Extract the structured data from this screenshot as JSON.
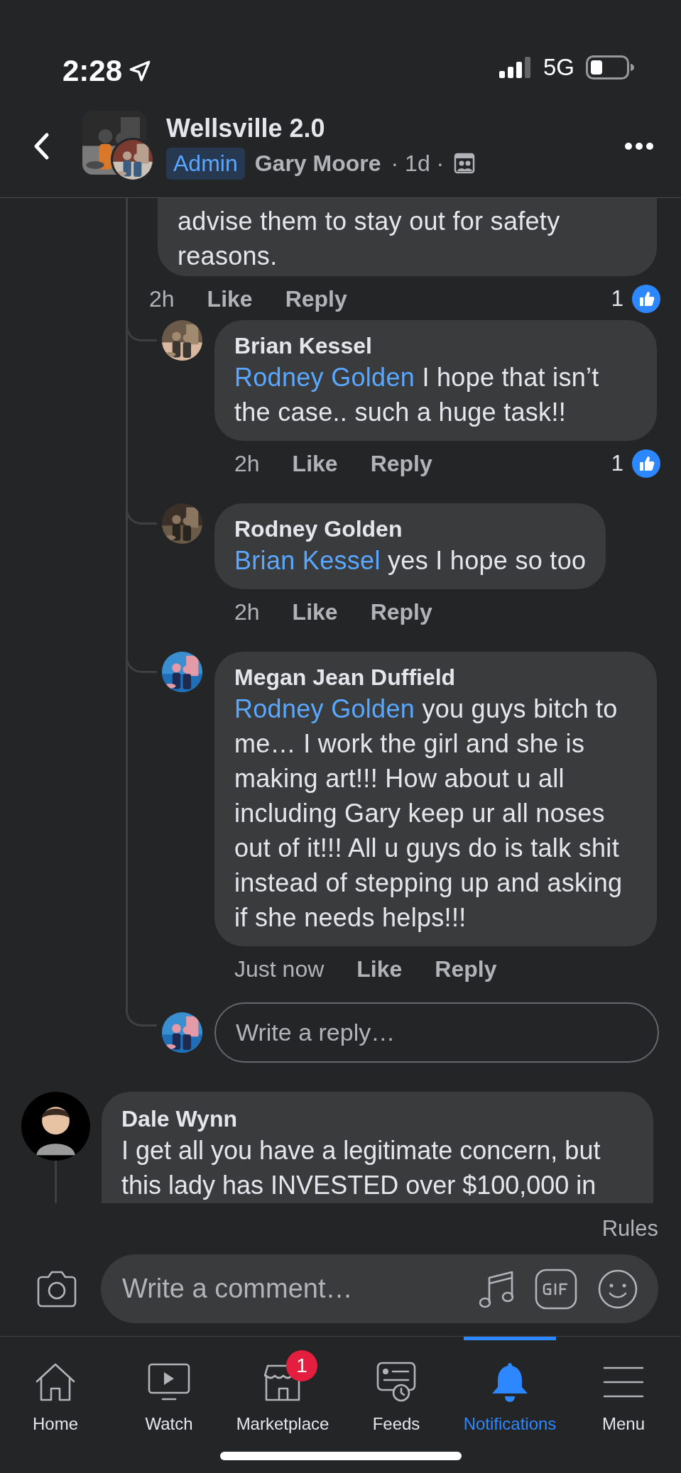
{
  "status_bar": {
    "time": "2:28",
    "network": "5G"
  },
  "header": {
    "title": "Wellsville 2.0",
    "badge": "Admin",
    "author": "Gary Moore",
    "meta": "· 1d ·"
  },
  "partial_comment": {
    "lines": [
      "advise them to stay out for safety",
      "reasons."
    ],
    "time": "2h",
    "like": "Like",
    "reply": "Reply",
    "reactions": "1"
  },
  "replies": [
    {
      "name": "Brian Kessel",
      "mention": "Rodney Golden",
      "text": "I hope that isn’t the case.. such a huge task!!",
      "time": "2h",
      "like": "Like",
      "reply": "Reply",
      "reactions": "1"
    },
    {
      "name": "Rodney Golden",
      "mention": "Brian Kessel",
      "text": "yes I hope so too",
      "time": "2h",
      "like": "Like",
      "reply": "Reply"
    },
    {
      "name": "Megan Jean Duffield",
      "mention": "Rodney Golden",
      "text": "you guys bitch to me… I work the girl and she is making art!!! How about u all including Gary keep ur all noses out of it!!! All u guys do is talk shit instead of stepping up and asking if she needs helps!!!",
      "time": "Just now",
      "like": "Like",
      "reply": "Reply"
    }
  ],
  "reply_field": {
    "placeholder": "Write a reply…"
  },
  "next_comment": {
    "name": "Dale Wynn",
    "lines": [
      "I get all you have a legitimate concern, but",
      "this lady has INVESTED over $100,000 in"
    ]
  },
  "composer": {
    "rules": "Rules",
    "placeholder": "Write a comment…"
  },
  "tabs": [
    {
      "label": "Home",
      "kind": "home",
      "selected": false
    },
    {
      "label": "Watch",
      "kind": "watch",
      "selected": false
    },
    {
      "label": "Marketplace",
      "kind": "shop",
      "badge": "1",
      "selected": false
    },
    {
      "label": "Feeds",
      "kind": "feeds",
      "selected": false
    },
    {
      "label": "Notifications",
      "kind": "bell",
      "selected": true
    },
    {
      "label": "Menu",
      "kind": "menu",
      "selected": false
    }
  ]
}
